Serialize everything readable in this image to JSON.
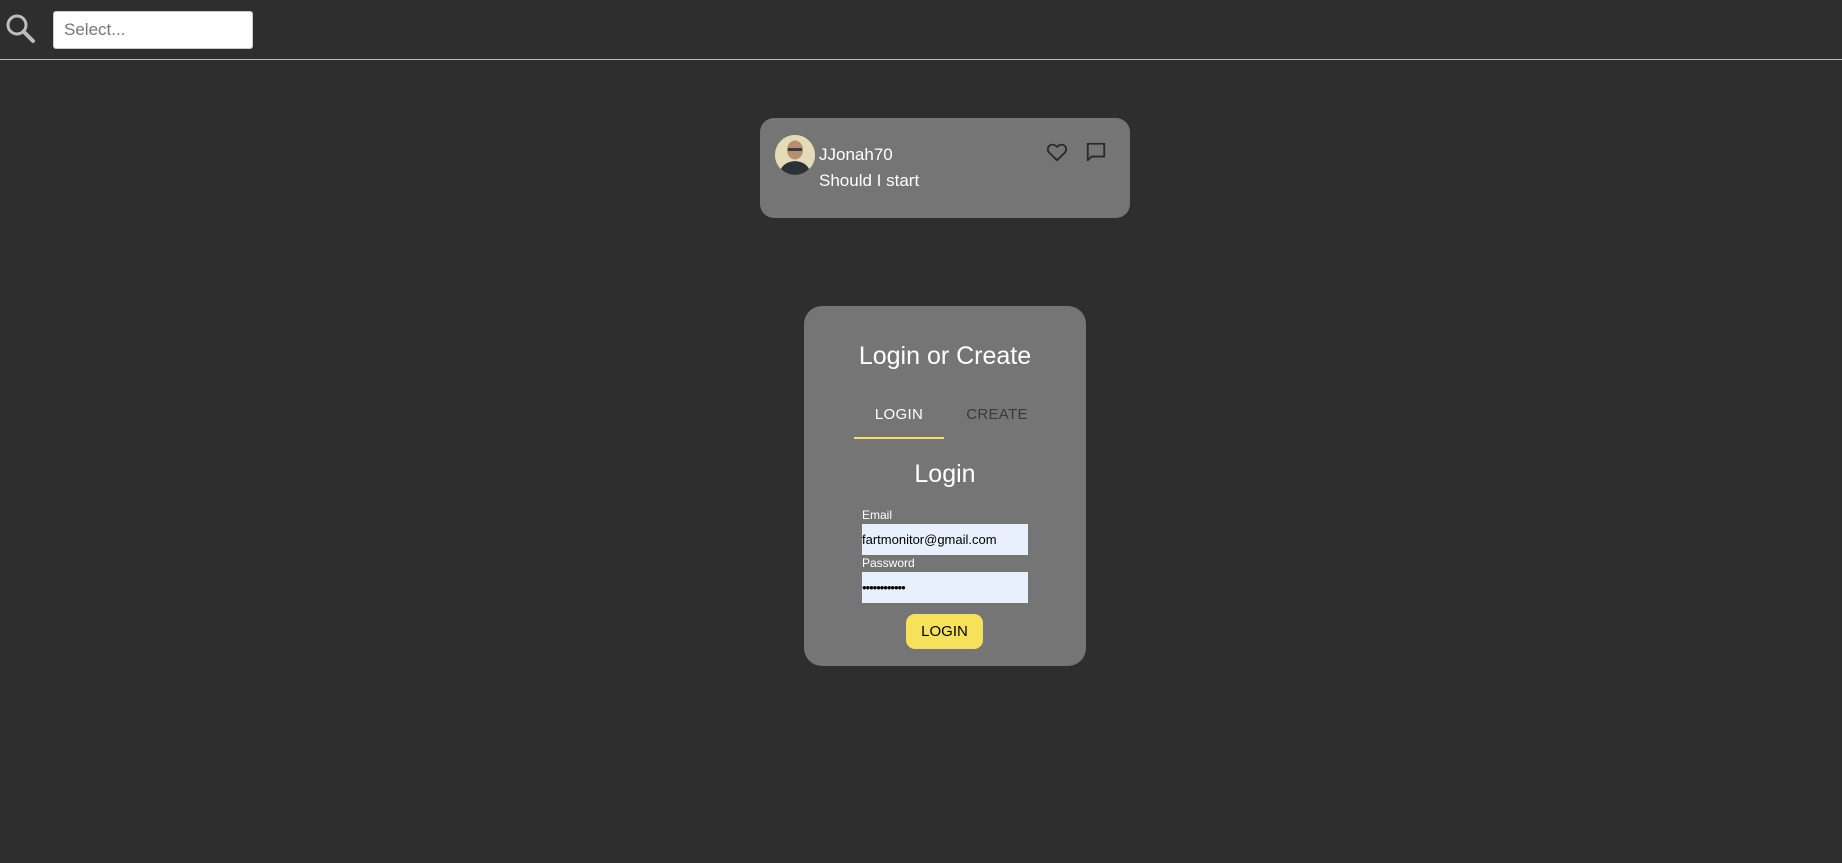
{
  "header": {
    "search_icon": "search-icon",
    "select_placeholder": "Select..."
  },
  "post": {
    "username": "JJonah70",
    "text": "Should I start",
    "icons": [
      "heart-icon",
      "comment-icon"
    ]
  },
  "auth": {
    "title": "Login or Create",
    "tabs": [
      {
        "label": "LOGIN",
        "active": true
      },
      {
        "label": "CREATE",
        "active": false
      }
    ],
    "form_title": "Login",
    "email_label": "Email",
    "email_value": "fartmonitor@gmail.com",
    "password_label": "Password",
    "password_value": "••••••••••••",
    "login_button": "LOGIN"
  },
  "colors": {
    "background": "#2e2e2e",
    "card": "#757575",
    "accent": "#f5e15a",
    "input_bg": "#e8f0fe"
  }
}
